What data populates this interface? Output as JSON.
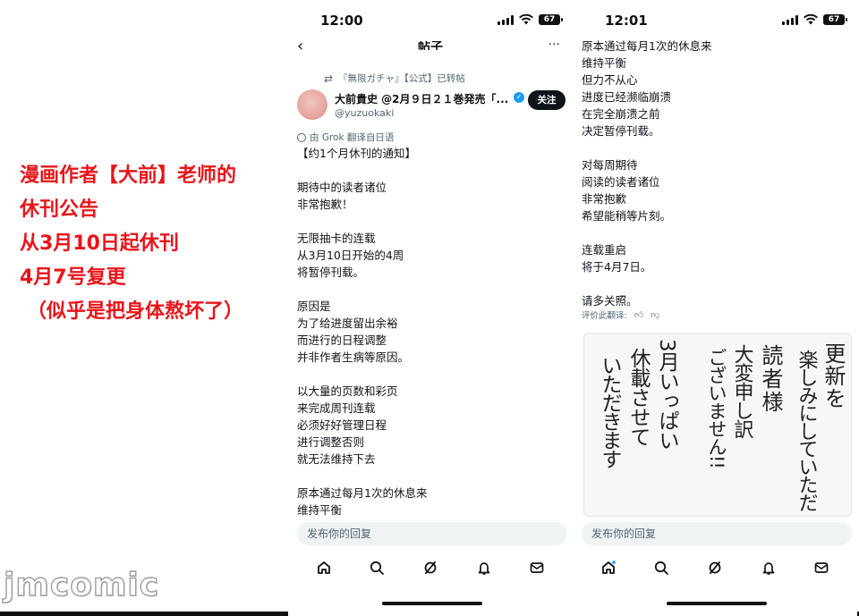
{
  "caption": {
    "lines": [
      "漫画作者【大前】老师的",
      "休刊公告",
      "从3月10日起休刊",
      "4月7号复更",
      "（似乎是把身体熬坏了）"
    ],
    "color": "#e8141a"
  },
  "watermark": "jmcomic",
  "phone1": {
    "time": "12:00",
    "battery": "67",
    "nav_title": "帖子",
    "repost_text": "『無限ガチャ』【公式】已转帖",
    "author_name": "大前貴史 @2月９日２１巻発売「...",
    "handle": "@yuzuokaki",
    "follow_label": "关注",
    "translate_note": "由 Grok 翻译自日语",
    "paragraphs": [
      [
        "【约1个月休刊的通知】"
      ],
      [
        "期待中的读者诸位",
        "非常抱歉！"
      ],
      [
        "无限抽卡的连载",
        "从3月10日开始的4周",
        "将暂停刊载。"
      ],
      [
        "原因是",
        "为了给进度留出余裕",
        "而进行的日程调整",
        "并非作者生病等原因。"
      ],
      [
        "以大量的页数和彩页",
        "来完成周刊连载",
        "必须好好管理日程",
        "进行调整否则",
        "就无法维持下去"
      ],
      [
        "原本通过每月1次的休息来",
        "维持平衡"
      ]
    ],
    "reply_placeholder": "发布你的回复"
  },
  "phone2": {
    "time": "12:01",
    "battery": "67",
    "paragraphs": [
      [
        "原本通过每月1次的休息来",
        "维持平衡",
        "但力不从心",
        "进度已经濒临崩溃",
        "在完全崩溃之前",
        "决定暂停刊载。"
      ],
      [
        "对每周期待",
        "阅读的读者诸位",
        "非常抱歉",
        "希望能稍等片刻。"
      ],
      [
        "连载重启",
        "将于4月7日。"
      ],
      [
        "请多关照。"
      ]
    ],
    "rate_label": "评价此翻译:",
    "handwritten_note": [
      "読者様",
      "大変申し訳",
      "ございません!!",
      "3月いっぱい",
      "休載させて",
      "いただきます",
      "更新を",
      "楽しみにしていただ"
    ],
    "reply_placeholder": "发布你的回复"
  },
  "tabs": [
    "home-icon",
    "search-icon",
    "grok-icon",
    "notifications-icon",
    "messages-icon"
  ]
}
